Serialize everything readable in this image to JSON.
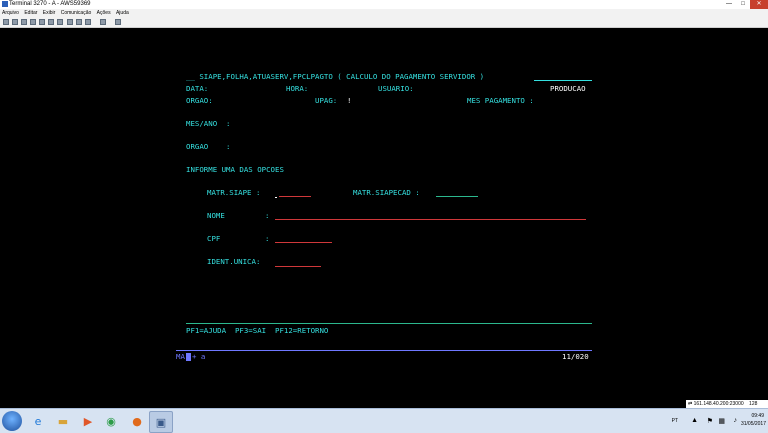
{
  "window": {
    "title": "Terminal 3270 - A - AWS59369"
  },
  "menu": [
    "Arquivo",
    "Editar",
    "Exibir",
    "Comunicação",
    "Ações",
    "Ajuda"
  ],
  "toolbar": {
    "icons": [
      "print-icon",
      "copy-icon",
      "paste-icon",
      "send-icon",
      "receive-icon",
      "color-icon",
      "keyboard-icon",
      "macro-icon",
      "record-icon",
      "play-icon",
      "settings-icon",
      "help-icon"
    ]
  },
  "terminal": {
    "header": {
      "title_prefix": "__ SIAPE,FOLHA,ATUASERV,FPCLPAGTO ( CALCULO DO PAGAMENTO SERVIDOR )",
      "data_label": "DATA:",
      "hora_label": "HORA:",
      "usuario_label": "USUARIO:",
      "env_value": "PRODUCAO",
      "orgao_label": "ORGAO:",
      "upag_label": "UPAG:",
      "upag_sep": "!",
      "mes_pagamento_label": "MES PAGAMENTO :"
    },
    "mesano_label": "MES/ANO  :",
    "orgao2_label": "ORGAO    :",
    "instruction": "INFORME UMA DAS OPCOES",
    "fields": {
      "matr_siape_label": "MATR.SIAPE :",
      "matr_siapecad_label": "MATR.SIAPECAD :",
      "nome_label": "NOME",
      "nome_colon": ":",
      "cpf_label": "CPF",
      "cpf_colon": ":",
      "ident_unica_label": "IDENT.UNICA:"
    },
    "footer_keys": "PF1=AJUDA  PF3=SAI  PF12=RETORNO",
    "status": {
      "oia_left": "MA",
      "oia_mid": "+  a",
      "cursor_position": "11/020"
    }
  },
  "statusbox": {
    "text": "161.148.40.200:23000",
    "session": "128"
  },
  "taskbar": {
    "apps": [
      "ie-icon",
      "explorer-icon",
      "media-player-icon",
      "chrome-icon",
      "firefox-icon",
      "terminal-app-icon"
    ],
    "tray": {
      "lang": "PT",
      "time": "09:49",
      "date": "31/05/2017"
    }
  },
  "colors": {
    "field_text": "#35e0e0",
    "input_underline": "#d0383a",
    "separator": "#2cb88e",
    "oia": "#6f78ff"
  }
}
